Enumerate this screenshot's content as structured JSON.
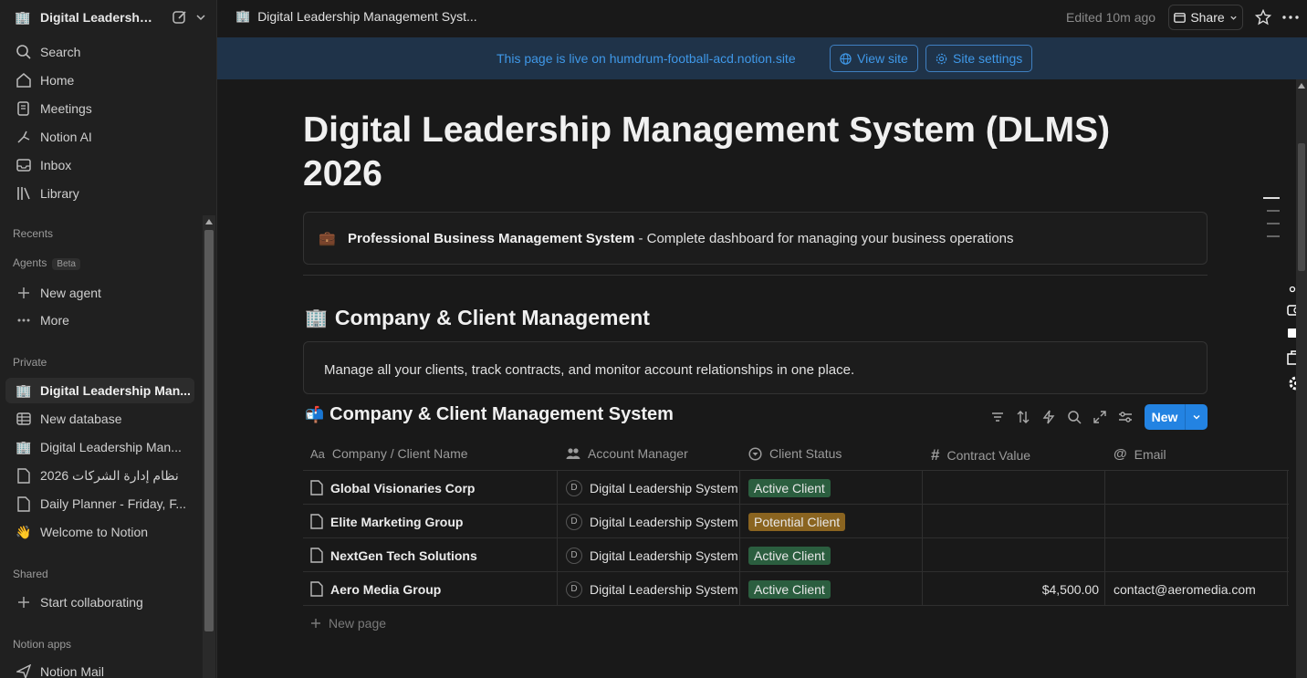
{
  "sidebar": {
    "workspace_name": "Digital Leadershi...",
    "nav": [
      {
        "label": "Search",
        "icon": "search-icon"
      },
      {
        "label": "Home",
        "icon": "home-icon"
      },
      {
        "label": "Meetings",
        "icon": "meetings-icon"
      },
      {
        "label": "Notion AI",
        "icon": "notion-ai-icon"
      },
      {
        "label": "Inbox",
        "icon": "inbox-icon"
      },
      {
        "label": "Library",
        "icon": "library-icon"
      }
    ],
    "recents_label": "Recents",
    "agents_label": "Agents",
    "agents_badge": "Beta",
    "new_agent": "New agent",
    "more": "More",
    "private_label": "Private",
    "private_items": [
      {
        "label": "Digital Leadership Man...",
        "icon": "office-icon"
      },
      {
        "label": "New database",
        "icon": "table-icon"
      },
      {
        "label": "Digital Leadership Man...",
        "icon": "office-icon"
      },
      {
        "label": "نظام إدارة الشركات 2026",
        "icon": "page-icon"
      },
      {
        "label": "Daily Planner - Friday, F...",
        "icon": "page-icon"
      },
      {
        "label": "Welcome to Notion",
        "icon": "wave-icon"
      }
    ],
    "shared_label": "Shared",
    "start_collaborating": "Start collaborating",
    "apps_label": "Notion apps",
    "notion_mail": "Notion Mail"
  },
  "topbar": {
    "breadcrumb": "Digital Leadership Management Syst...",
    "edited": "Edited 10m ago",
    "share": "Share"
  },
  "banner": {
    "text": "This page is live on humdrum-football-acd.notion.site",
    "view_site": "View site",
    "site_settings": "Site settings"
  },
  "page": {
    "title": "Digital Leadership Management System (DLMS) 2026",
    "callout_bold": "Professional Business Management System",
    "callout_rest": " - Complete dashboard for managing your business operations",
    "section_heading": "Company & Client Management",
    "section_desc": "Manage all your clients, track contracts, and monitor account relationships in one place.",
    "db_title": "Company & Client Management System",
    "new_button": "New"
  },
  "table": {
    "columns": [
      {
        "label": "Company / Client Name",
        "icon": "text-type-icon"
      },
      {
        "label": "Account Manager",
        "icon": "people-icon"
      },
      {
        "label": "Client Status",
        "icon": "status-icon"
      },
      {
        "label": "Contract Value",
        "icon": "number-icon"
      },
      {
        "label": "Email",
        "icon": "at-icon"
      }
    ],
    "rows": [
      {
        "name": "Global Visionaries Corp",
        "manager": "Digital Leadership System",
        "avatar": "D",
        "status": "Active Client",
        "value": "",
        "email": ""
      },
      {
        "name": "Elite Marketing Group",
        "manager": "Digital Leadership System",
        "avatar": "D",
        "status": "Potential Client",
        "value": "",
        "email": ""
      },
      {
        "name": "NextGen Tech Solutions",
        "manager": "Digital Leadership System",
        "avatar": "D",
        "status": "Active Client",
        "value": "",
        "email": ""
      },
      {
        "name": "Aero Media Group",
        "manager": "Digital Leadership System",
        "avatar": "D",
        "status": "Active Client",
        "value": "$4,500.00",
        "email": "contact@aeromedia.com"
      }
    ],
    "new_page": "New page"
  },
  "colors": {
    "active_tag": "#2b5e3f",
    "potential_tag": "#8a6420",
    "accent": "#2383e2",
    "banner_bg": "#1f3349"
  }
}
